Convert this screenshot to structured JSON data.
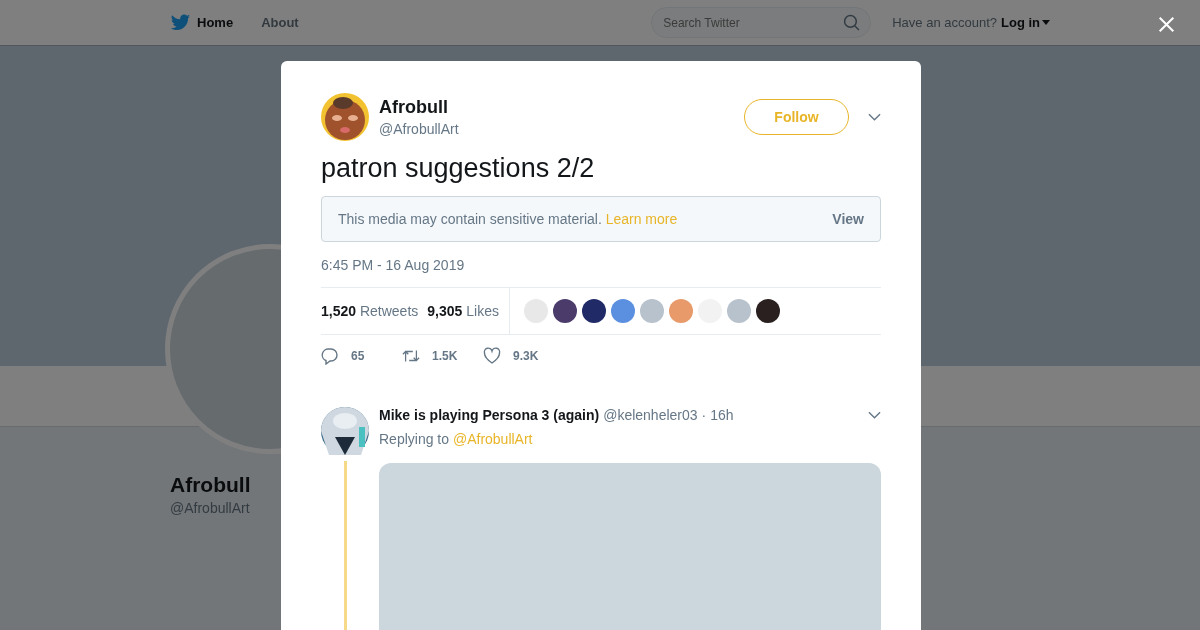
{
  "nav": {
    "items": [
      {
        "label": "Home",
        "selected": true
      },
      {
        "label": "About",
        "selected": false
      }
    ],
    "search": {
      "placeholder": "Search Twitter"
    },
    "account_prompt": "Have an account?",
    "login": "Log in"
  },
  "profile": {
    "name": "Afrobull",
    "handle": "@AfrobullArt"
  },
  "tweet": {
    "name": "Afrobull",
    "handle": "@AfrobullArt",
    "follow": "Follow",
    "text": "patron suggestions 2/2",
    "sensitive": {
      "message": "This media may contain sensitive material.",
      "link": "Learn more",
      "button": "View"
    },
    "time": "6:45 PM - 16 Aug 2019",
    "stats": [
      {
        "count": "1,520",
        "label": "Retweets"
      },
      {
        "count": "9,305",
        "label": "Likes"
      }
    ],
    "likers": [
      {
        "color": "#e8e8e8"
      },
      {
        "color": "#4a3b6b"
      },
      {
        "color": "#1f2a66"
      },
      {
        "color": "#5b8fe0"
      },
      {
        "color": "#b8c2cc"
      },
      {
        "color": "#e89a6a"
      },
      {
        "color": "#f2f2f2"
      },
      {
        "color": "#b8c2cc"
      },
      {
        "color": "#2a2020"
      }
    ],
    "actions": [
      {
        "kind": "reply",
        "count": "65"
      },
      {
        "kind": "retweet",
        "count": "1.5K"
      },
      {
        "kind": "like",
        "count": "9.3K"
      }
    ]
  },
  "reply": {
    "name": "Mike is playing Persona 3 (again)",
    "handle": "@kelenheler03",
    "time": "· 16h",
    "replying_to": "Replying to",
    "mention": "@AfrobullArt"
  }
}
